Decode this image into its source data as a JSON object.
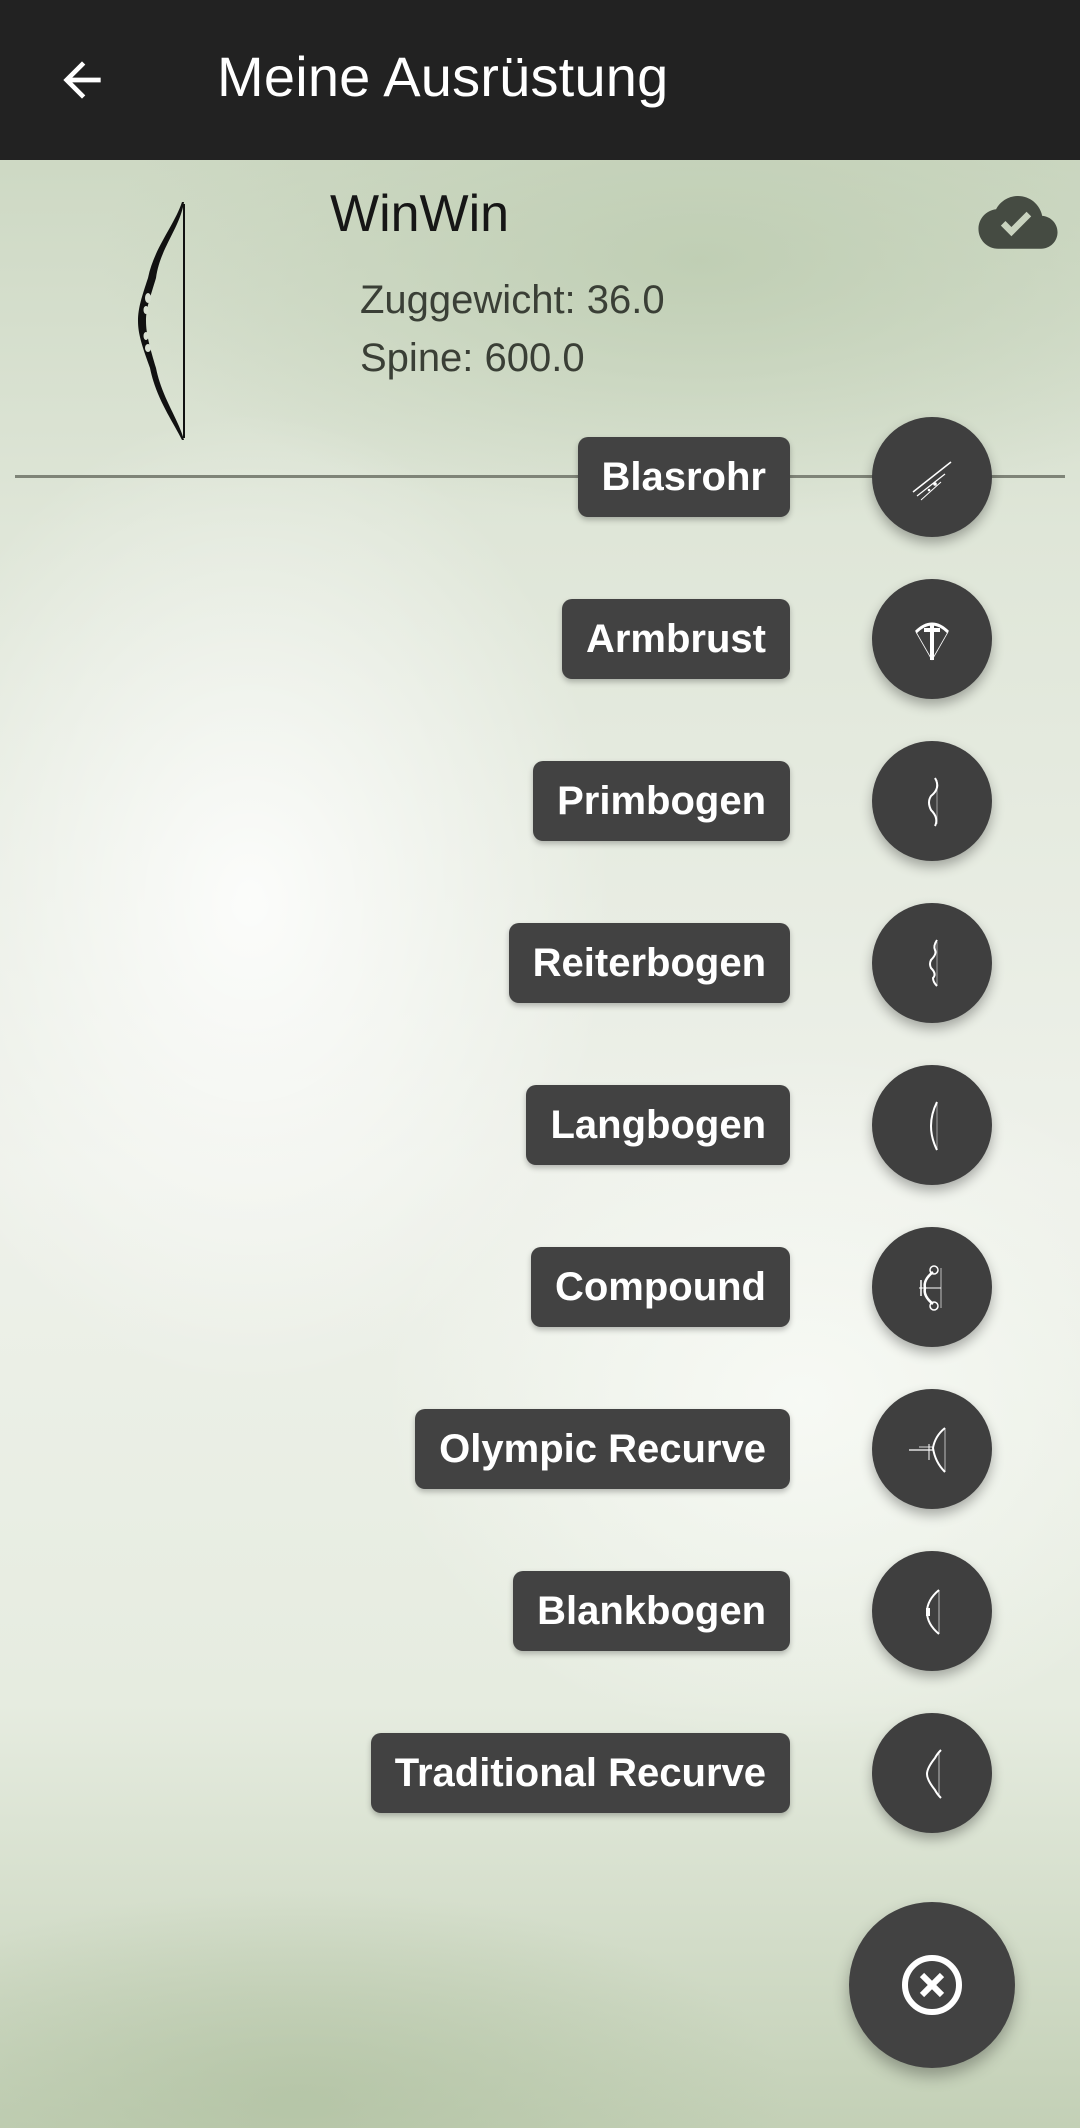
{
  "appbar": {
    "title": "Meine Ausrüstung",
    "back_icon": "arrow-left-icon",
    "background_color": "#222222"
  },
  "item": {
    "name": "WinWin",
    "image_icon": "recurve-bow-icon",
    "properties": [
      {
        "label": "Zuggewicht: 36.0"
      },
      {
        "label": "Spine: 600.0"
      }
    ],
    "sync_status_icon": "cloud-done-icon"
  },
  "speed_dial": {
    "items": [
      {
        "label": "Blasrohr",
        "icon": "blowgun-icon"
      },
      {
        "label": "Armbrust",
        "icon": "crossbow-icon"
      },
      {
        "label": "Primbogen",
        "icon": "primitive-bow-icon"
      },
      {
        "label": "Reiterbogen",
        "icon": "horse-bow-icon"
      },
      {
        "label": "Langbogen",
        "icon": "longbow-icon"
      },
      {
        "label": "Compound",
        "icon": "compound-bow-icon"
      },
      {
        "label": "Olympic Recurve",
        "icon": "olympic-recurve-icon"
      },
      {
        "label": "Blankbogen",
        "icon": "barebow-icon"
      },
      {
        "label": "Traditional Recurve",
        "icon": "traditional-recurve-icon"
      }
    ],
    "close_icon": "close-circle-icon",
    "fab_color": "#424242",
    "chip_color": "#424242"
  }
}
